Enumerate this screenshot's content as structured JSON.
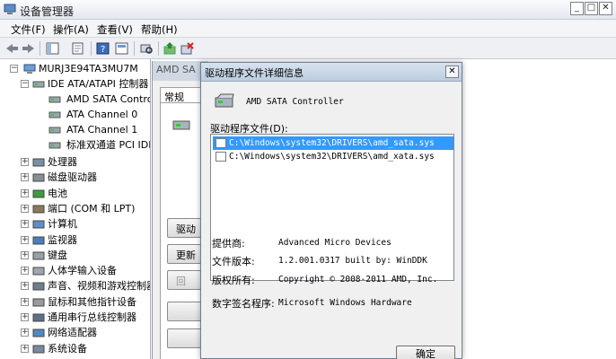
{
  "window": {
    "title": "设备管理器"
  },
  "menu": [
    "文件(F)",
    "操作(A)",
    "查看(V)",
    "帮助(H)"
  ],
  "tree": {
    "root": "MURJ3E94TA3MU7M",
    "ide": "IDE ATA/ATAPI 控制器",
    "ide_children": [
      "AMD SATA Contro",
      "ATA Channel 0",
      "ATA Channel 1",
      "标准双通道 PCI IDE"
    ],
    "categories": [
      "处理器",
      "磁盘驱动器",
      "电池",
      "端口 (COM 和 LPT)",
      "计算机",
      "监视器",
      "键盘",
      "人体学输入设备",
      "声音、视频和游戏控制器",
      "鼠标和其他指针设备",
      "通用串行总线控制器",
      "网络适配器",
      "系统设备"
    ]
  },
  "props": {
    "title": "AMD SA",
    "tab": "常规",
    "btn1": "驱动",
    "btn2": "更新",
    "btn3": "回"
  },
  "dialog": {
    "title": "驱动程序文件详细信息",
    "device": "AMD SATA Controller",
    "files_label": "驱动程序文件(D):",
    "files": [
      "C:\\Windows\\system32\\DRIVERS\\amd_sata.sys",
      "C:\\Windows\\system32\\DRIVERS\\amd_xata.sys"
    ],
    "provider_label": "提供商:",
    "provider": "Advanced Micro Devices",
    "version_label": "文件版本:",
    "version": "1.2.001.0317 built by: WinDDK",
    "copyright_label": "版权所有:",
    "copyright": "Copyright © 2008-2011 AMD, Inc.",
    "signer_label": "数字签名程序:",
    "signer": "Microsoft Windows Hardware",
    "ok": "确定"
  },
  "colors": {
    "selection": "#3399ff",
    "titlebar": "#dfe6ee"
  }
}
